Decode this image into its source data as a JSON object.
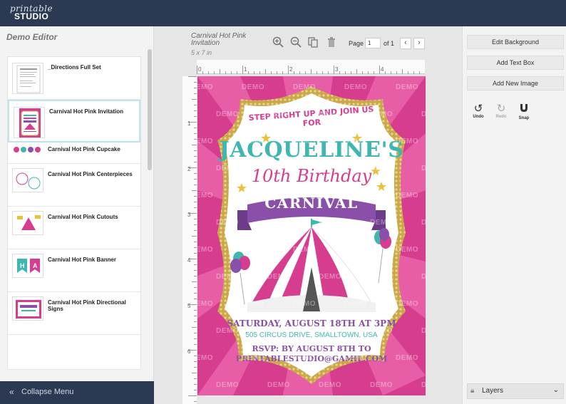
{
  "app": {
    "logo_line1": "printable",
    "logo_line2": "STUDIO"
  },
  "sidebar": {
    "title": "Demo Editor",
    "items": [
      {
        "label": "_Directions Full Set",
        "thumb": "directions"
      },
      {
        "label": "Carnival Hot Pink Invitation",
        "thumb": "invitation"
      },
      {
        "label": "Carnival Hot Pink Cupcake",
        "thumb": "cupcake"
      },
      {
        "label": "Carnival Hot Pink Centerpieces",
        "thumb": "centerpieces"
      },
      {
        "label": "Carnival Hot Pink Cutouts",
        "thumb": "cutouts"
      },
      {
        "label": "Carnival Hot Pink Banner",
        "thumb": "banner"
      },
      {
        "label": "Carnival Hot Pink Directional Signs",
        "thumb": "signs"
      }
    ],
    "collapse_label": "Collapse Menu",
    "collapse_icon": "double-chevron-left-icon"
  },
  "editor": {
    "doc_title": "Carnival Hot Pink Invitation",
    "doc_size": "5 x 7 in",
    "page_label": "Page",
    "page_value": "1",
    "of_label": "of 1",
    "prev_icon": "‹",
    "next_icon": "›",
    "ruler_top": [
      "0",
      "1",
      "2",
      "3",
      "4"
    ],
    "ruler_left": [
      "1",
      "2",
      "3",
      "4",
      "5",
      "6"
    ]
  },
  "invitation": {
    "line1": "STEP RIGHT UP AND JOIN US FOR",
    "name": "JACQUELINE'S",
    "line3": "10th Birthday",
    "banner": "CARNIVAL",
    "date": "SATURDAY, AUGUST 18TH AT 3PM",
    "address": "505 CIRCUS DRIVE, SMALLTOWN, USA",
    "rsvp1": "RSVP: BY AUGUST 8TH TO",
    "rsvp2": "PRINTABLESTUDIO@GAMIL.COM",
    "watermark": "DEMO",
    "colors": {
      "pink": "#d63d8f",
      "teal": "#3fb7b0",
      "purple": "#8a4fa8",
      "gold": "#c9a84a"
    }
  },
  "rightpanel": {
    "edit_background": "Edit Background",
    "add_text_box": "Add Text Box",
    "add_new_image": "Add New Image",
    "undo": "Undo",
    "redo": "Redo",
    "snap": "Snap",
    "layers": "Layers"
  },
  "colors": {
    "header": "#2b3a52",
    "panel": "#f3f3f3"
  }
}
